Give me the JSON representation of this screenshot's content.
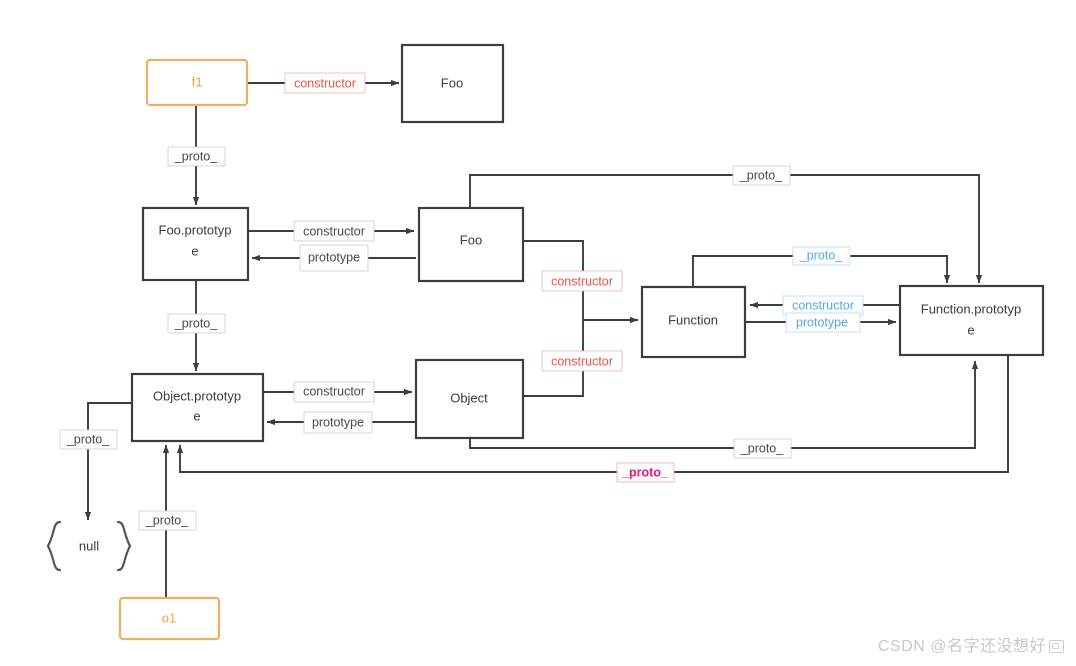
{
  "diagram": {
    "title": "JavaScript prototype chain diagram",
    "colors": {
      "node_border": "#3d3d3d",
      "instance_border": "#eab166",
      "instance_text": "#e8a33d",
      "label_red": "#e8554e",
      "label_blue": "#5aa9e6",
      "label_pink": "#e8177d",
      "label_dark": "#4a4a4a",
      "background": "#ffffff"
    },
    "nodes": [
      {
        "id": "f1",
        "label": "f1",
        "style": "instance"
      },
      {
        "id": "foo_ctor_top",
        "label": "Foo",
        "style": "plain"
      },
      {
        "id": "foo_prototype",
        "label": "Foo.prototype",
        "style": "plain"
      },
      {
        "id": "foo_ctor_mid",
        "label": "Foo",
        "style": "plain"
      },
      {
        "id": "object_prototype",
        "label": "Object.prototype",
        "style": "plain"
      },
      {
        "id": "object_ctor",
        "label": "Object",
        "style": "plain"
      },
      {
        "id": "function_ctor",
        "label": "Function",
        "style": "plain"
      },
      {
        "id": "function_prototype",
        "label": "Function.prototype",
        "style": "plain"
      },
      {
        "id": "null_node",
        "label": "null",
        "style": "brace"
      },
      {
        "id": "o1",
        "label": "o1",
        "style": "instance"
      }
    ],
    "edge_labels": {
      "f1_to_foo": "constructor",
      "f1_proto": "_proto_",
      "fooproto_constructor": "constructor",
      "foo_prototype_back": "prototype",
      "fooproto_proto": "_proto_",
      "objproto_constructor": "constructor",
      "object_prototype_back": "prototype",
      "foo_constructor_function": "constructor",
      "object_constructor_function": "constructor",
      "funcproto_constructor": "constructor",
      "function_prototype_out": "prototype",
      "funcproto_self_proto": "_proto_",
      "foo_proto_to_funcproto": "_proto_",
      "object_proto_to_funcproto": "_proto_",
      "funcproto_proto_to_objproto": "_proto_",
      "objproto_to_null": "_proto_",
      "o1_proto": "_proto_"
    },
    "watermark": {
      "text": "CSDN @名字还没想好"
    }
  }
}
